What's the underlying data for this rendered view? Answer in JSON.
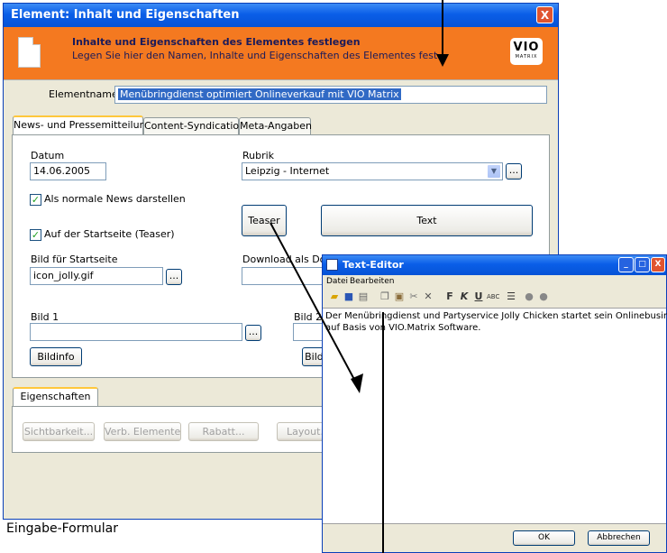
{
  "main_window": {
    "title": "Element: Inhalt und Eigenschaften",
    "close_glyph": "X",
    "banner": {
      "title": "Inhalte und Eigenschaften des Elementes festlegen",
      "subtitle": "Legen Sie hier den Namen, Inhalte und Eigenschaften des Elementes fest.",
      "logo_text": "VIO",
      "logo_sub": "MATRIX"
    },
    "elementname": {
      "label": "Elementname",
      "value": "Menübringdienst optimiert Onlineverkauf mit VIO Matrix"
    },
    "tabs": [
      "News- und Pressemitteilung",
      "Content-Syndication",
      "Meta-Angaben"
    ],
    "datum": {
      "label": "Datum",
      "value": "14.06.2005"
    },
    "rubrik": {
      "label": "Rubrik",
      "value": "Leipzig - Internet"
    },
    "checkbox_news": {
      "label": "Als normale News darstellen",
      "checked": true
    },
    "checkbox_start": {
      "label": "Auf der Startseite (Teaser)",
      "checked": true
    },
    "teaser_button": "Teaser",
    "text_button": "Text",
    "bild_startseite": {
      "label": "Bild für Startseite",
      "value": "icon_jolly.gif"
    },
    "download": {
      "label": "Download als Doku"
    },
    "bild1": {
      "label": "Bild 1",
      "value": ""
    },
    "bild2": {
      "label": "Bild 2"
    },
    "bildinfo_button": "Bildinfo",
    "bildinfo2_button": "Bildi",
    "dots": "...",
    "eigenschaften_tab": "Eigenschaften",
    "prop_buttons": [
      "Sichtbarkeit...",
      "Verb. Elemente",
      "Rabatt...",
      "Layout..."
    ]
  },
  "text_editor": {
    "title": "Text-Editor",
    "menu": [
      "Datei",
      "Bearbeiten"
    ],
    "content": [
      "Der Menübringdienst und Partyservice Jolly Chicken startet sein Onlinebusiness",
      "auf Basis von VIO.Matrix Software."
    ],
    "ok_button": "OK",
    "cancel_button": "Abbrechen"
  },
  "caption": "Eingabe-Formular",
  "colors": {
    "banner": "#f47920",
    "titlebar": "#0a5ee8",
    "selection": "#316ac5"
  }
}
